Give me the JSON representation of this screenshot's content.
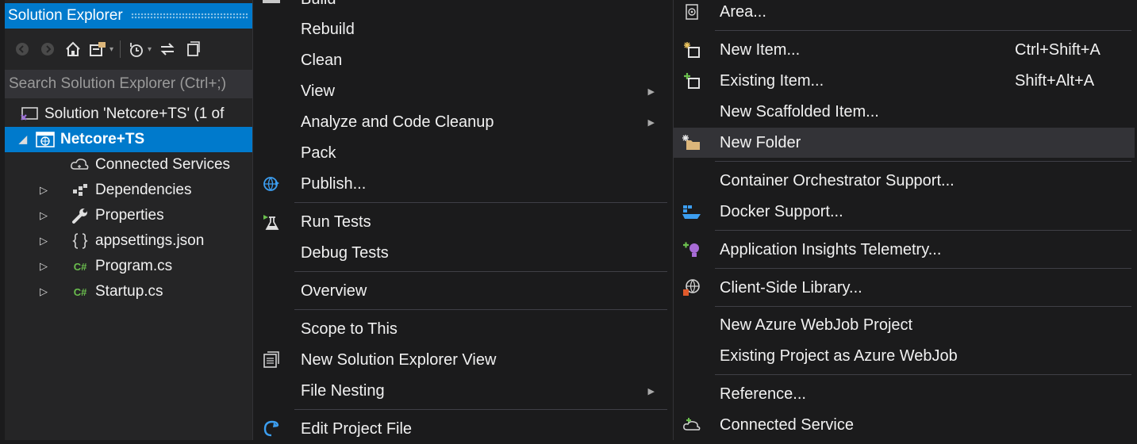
{
  "solution_explorer": {
    "title": "Solution Explorer",
    "search_placeholder": "Search Solution Explorer (Ctrl+;)",
    "toolbar_icons": [
      "back-icon",
      "forward-icon",
      "home-icon",
      "sync-with-document-icon",
      "pending-changes-filter-icon",
      "refresh-icon",
      "collapse-all-icon"
    ],
    "tree": [
      {
        "label": "Solution 'Netcore+TS' (1 of",
        "icon": "solution-icon",
        "expander": "",
        "indent": 0
      },
      {
        "label": "Netcore+TS",
        "icon": "web-project-icon",
        "expander": "◢",
        "indent": 1,
        "selected": true
      },
      {
        "label": "Connected Services",
        "icon": "connected-services-icon",
        "expander": "",
        "indent": 2
      },
      {
        "label": "Dependencies",
        "icon": "dependencies-icon",
        "expander": "▷",
        "indent": 2
      },
      {
        "label": "Properties",
        "icon": "wrench-icon",
        "expander": "▷",
        "indent": 2
      },
      {
        "label": "appsettings.json",
        "icon": "json-file-icon",
        "expander": "▷",
        "indent": 2
      },
      {
        "label": "Program.cs",
        "icon": "csharp-file-icon",
        "expander": "▷",
        "indent": 2
      },
      {
        "label": "Startup.cs",
        "icon": "csharp-file-icon",
        "expander": "▷",
        "indent": 2
      }
    ]
  },
  "context_menu": {
    "partial_top_label": "Build",
    "items": [
      {
        "label": "Rebuild"
      },
      {
        "label": "Clean"
      },
      {
        "label": "View",
        "submenu": true
      },
      {
        "label": "Analyze and Code Cleanup",
        "submenu": true
      },
      {
        "label": "Pack"
      },
      {
        "label": "Publish...",
        "icon": "publish-icon"
      },
      {
        "label": "Run Tests",
        "icon": "run-tests-icon"
      },
      {
        "label": "Debug Tests"
      },
      {
        "label": "Overview"
      },
      {
        "label": "Scope to This"
      },
      {
        "label": "New Solution Explorer View",
        "icon": "new-view-icon"
      },
      {
        "label": "File Nesting",
        "submenu": true
      },
      {
        "label": "Edit Project File",
        "icon": "edit-project-icon"
      }
    ]
  },
  "add_submenu": {
    "items": [
      {
        "label": "Area...",
        "icon": "area-icon"
      },
      {
        "label": "New Item...",
        "icon": "new-item-icon",
        "shortcut": "Ctrl+Shift+A"
      },
      {
        "label": "Existing Item...",
        "icon": "existing-item-icon",
        "shortcut": "Shift+Alt+A"
      },
      {
        "label": "New Scaffolded Item..."
      },
      {
        "label": "New Folder",
        "icon": "new-folder-icon",
        "highlighted": true
      },
      {
        "label": "Container Orchestrator Support..."
      },
      {
        "label": "Docker Support...",
        "icon": "docker-icon"
      },
      {
        "label": "Application Insights Telemetry...",
        "icon": "app-insights-icon"
      },
      {
        "label": "Client-Side Library...",
        "icon": "client-library-icon"
      },
      {
        "label": "New Azure WebJob Project"
      },
      {
        "label": "Existing Project as Azure WebJob"
      },
      {
        "label": "Reference..."
      },
      {
        "label": "Connected Service",
        "icon": "connected-service-icon"
      }
    ]
  },
  "colors": {
    "accent": "#007acc",
    "menu_bg": "#1b1b1c",
    "panel_bg": "#252526",
    "highlight": "#333337",
    "text": "#f1f1f1"
  }
}
